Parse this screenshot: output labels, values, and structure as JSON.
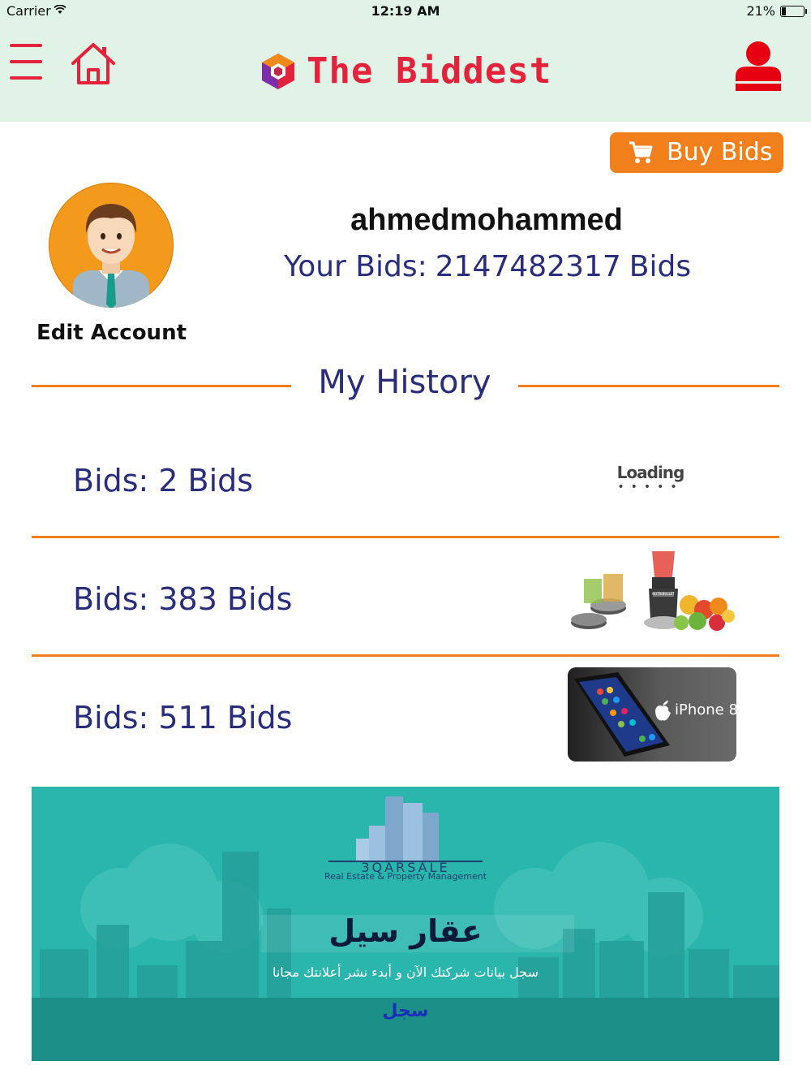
{
  "status_bar": {
    "carrier": "Carrier",
    "time": "12:19 AM",
    "battery": "21%"
  },
  "header": {
    "app_title": "The Biddest",
    "icons": {
      "menu": "menu-icon",
      "home": "home-icon",
      "user": "user-icon"
    }
  },
  "buy_bids": {
    "label": "Buy Bids",
    "icon": "cart-icon"
  },
  "profile": {
    "edit_label": "Edit Account",
    "username": "ahmedmohammed",
    "bids_prefix": "Your Bids:",
    "bids_value": "2147482317",
    "bids_suffix": "Bids"
  },
  "history": {
    "title": "My History",
    "items": [
      {
        "prefix": "Bids:",
        "value": "2",
        "suffix": "Bids",
        "image_label": "Loading",
        "image": "loading-placeholder"
      },
      {
        "prefix": "Bids:",
        "value": "383",
        "suffix": "Bids",
        "image_label": "NUTRIBULLET",
        "image": "blender-image"
      },
      {
        "prefix": "Bids:",
        "value": "511",
        "suffix": "Bids",
        "image_label": "iPhone 8",
        "image": "iphone-image"
      }
    ]
  },
  "banner": {
    "brand": "3QARSALE",
    "brand_sub": "Real Estate & Property Management",
    "title": "عقار سيل",
    "subtitle": "سجل بيانات شركتك الآن و أبدء نشر أعلانتك مجانا",
    "cta": "سجل"
  },
  "colors": {
    "accent_orange": "#f07f1c",
    "brand_red": "#e2233b",
    "navy_text": "#2a2d7a",
    "header_bg": "#e0f3e6",
    "banner_bg": "#2ab6ad"
  }
}
